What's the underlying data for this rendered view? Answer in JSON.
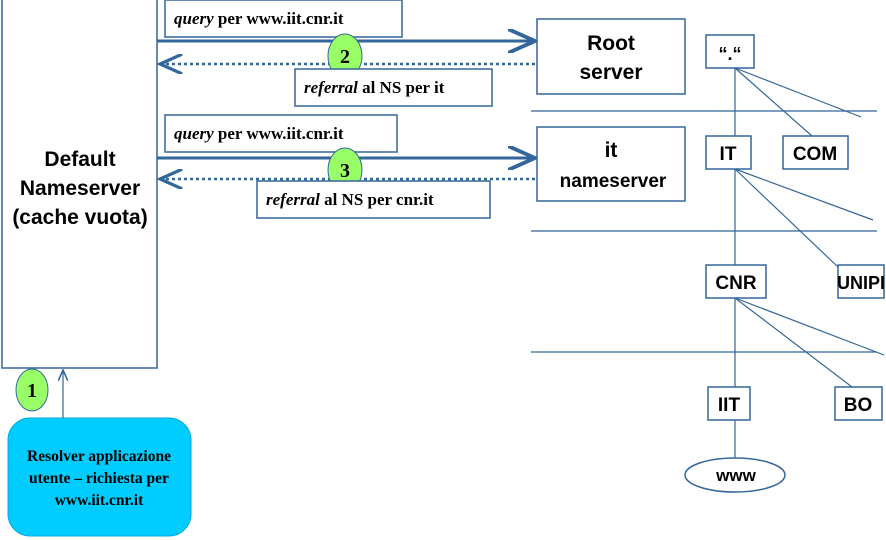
{
  "default_ns": {
    "lines": [
      "Default",
      "Nameserver",
      "(cache vuota)"
    ]
  },
  "resolver": {
    "lines": [
      "Resolver applicazione",
      "utente – richiesta per",
      "www.iit.cnr.it"
    ],
    "color": "#00ccff"
  },
  "steps": [
    "1",
    "2",
    "3"
  ],
  "step_color": "#99ff66",
  "query1": {
    "italic": "query",
    "rest": " per www.iit.cnr.it"
  },
  "referral1": {
    "italic": "referral",
    "rest": " al NS per it"
  },
  "query2": {
    "italic": "query",
    "rest": " per www.iit.cnr.it"
  },
  "referral2": {
    "italic": "referral",
    "rest": " al NS per cnr.it"
  },
  "root_server": {
    "lines": [
      "Root",
      "server"
    ]
  },
  "it_server": {
    "lines": [
      "it",
      "nameserver"
    ]
  },
  "tree": {
    "root": "“.“",
    "it": "IT",
    "com": "COM",
    "cnr": "CNR",
    "unipi": "UNIPI",
    "iit": "IIT",
    "bo": "BO",
    "www": "www"
  },
  "line_color": "#33669a"
}
